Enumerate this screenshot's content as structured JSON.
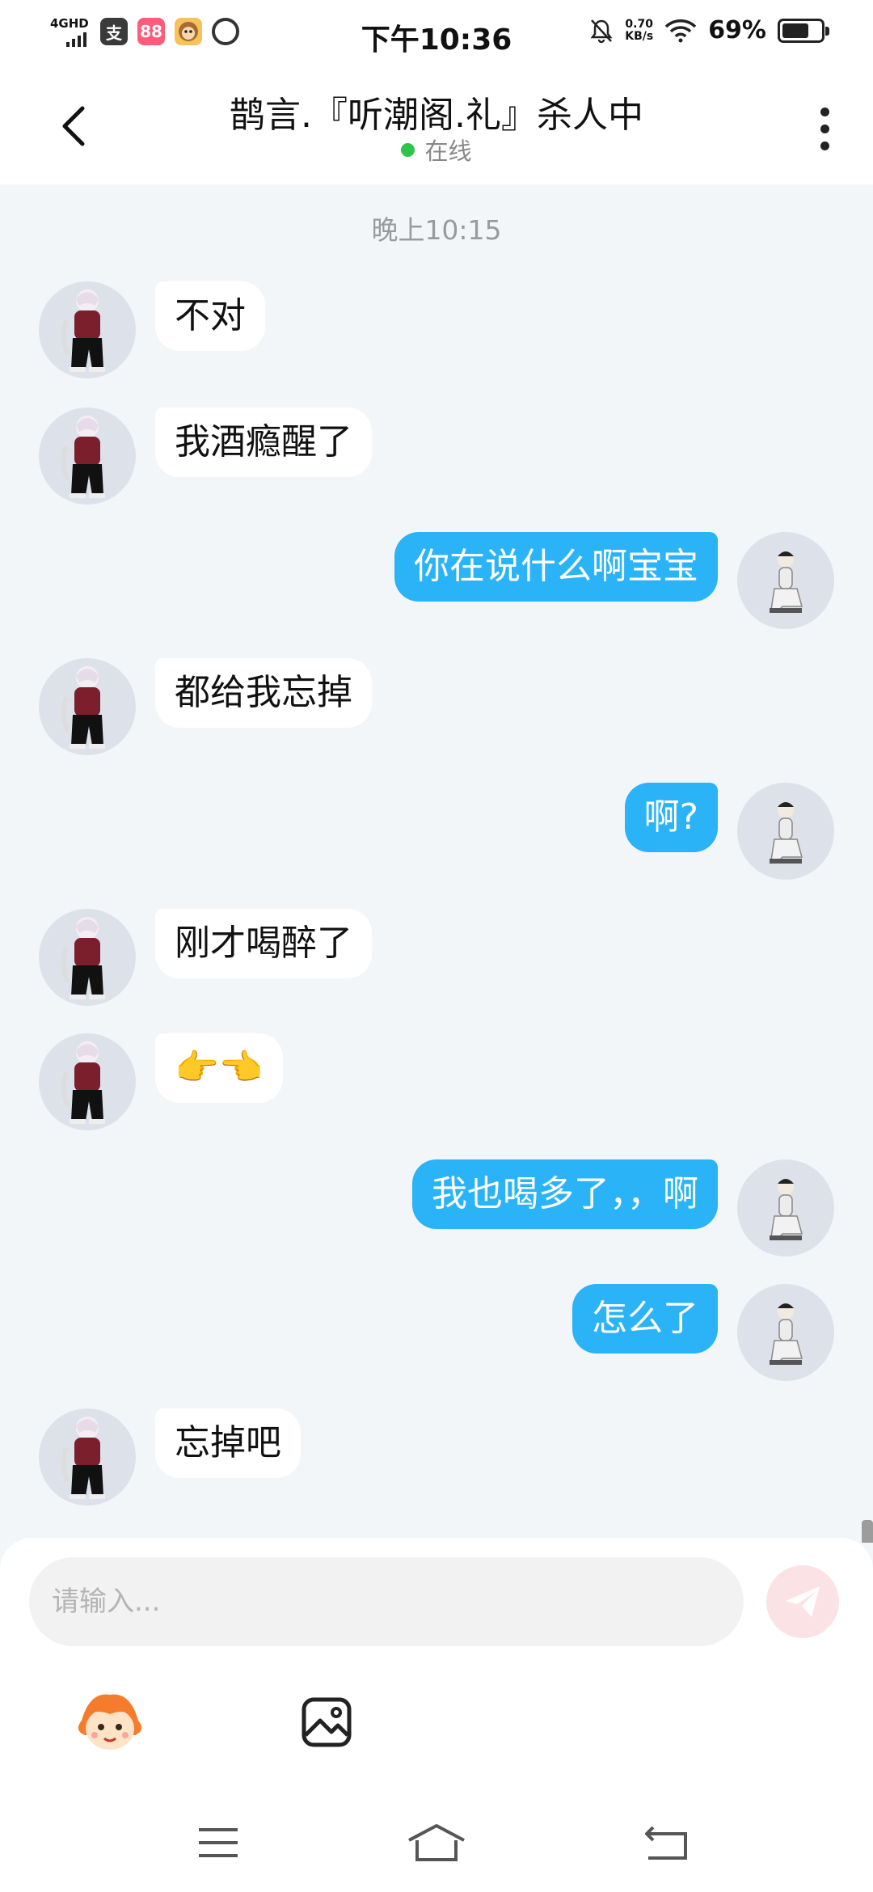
{
  "status_bar": {
    "network": "4GHD",
    "time": "下午10:36",
    "speed_value": "0.70",
    "speed_unit": "KB/s",
    "battery": "69%",
    "battery_level": 0.69
  },
  "header": {
    "title": "鹊言.『听潮阁.礼』杀人中",
    "status": "在线"
  },
  "chat": {
    "timestamp": "晚上10:15",
    "messages": [
      {
        "side": "left",
        "text": "不对"
      },
      {
        "side": "left",
        "text": "我酒瘾醒了"
      },
      {
        "side": "right",
        "text": "你在说什么啊宝宝"
      },
      {
        "side": "left",
        "text": "都给我忘掉"
      },
      {
        "side": "right",
        "text": "啊?"
      },
      {
        "side": "left",
        "text": "刚才喝醉了"
      },
      {
        "side": "left",
        "text": "👉👈"
      },
      {
        "side": "right",
        "text": "我也喝多了，，啊"
      },
      {
        "side": "right",
        "text": "怎么了"
      },
      {
        "side": "left",
        "text": "忘掉吧"
      }
    ]
  },
  "composer": {
    "placeholder": "请输入..."
  },
  "colors": {
    "outgoing_bubble": "#2ab3f6",
    "incoming_bubble": "#ffffff",
    "background": "#f3f6f9",
    "online_dot": "#2dc44a",
    "send_button": "#fbe3e5"
  },
  "icons": {
    "back": "chevron-left-icon",
    "more": "more-vertical-icon",
    "send": "paper-plane-icon",
    "emoji": "mascot-face-icon",
    "image": "image-icon",
    "nav_menu": "menu-icon",
    "nav_home": "home-icon",
    "nav_back": "back-icon"
  }
}
